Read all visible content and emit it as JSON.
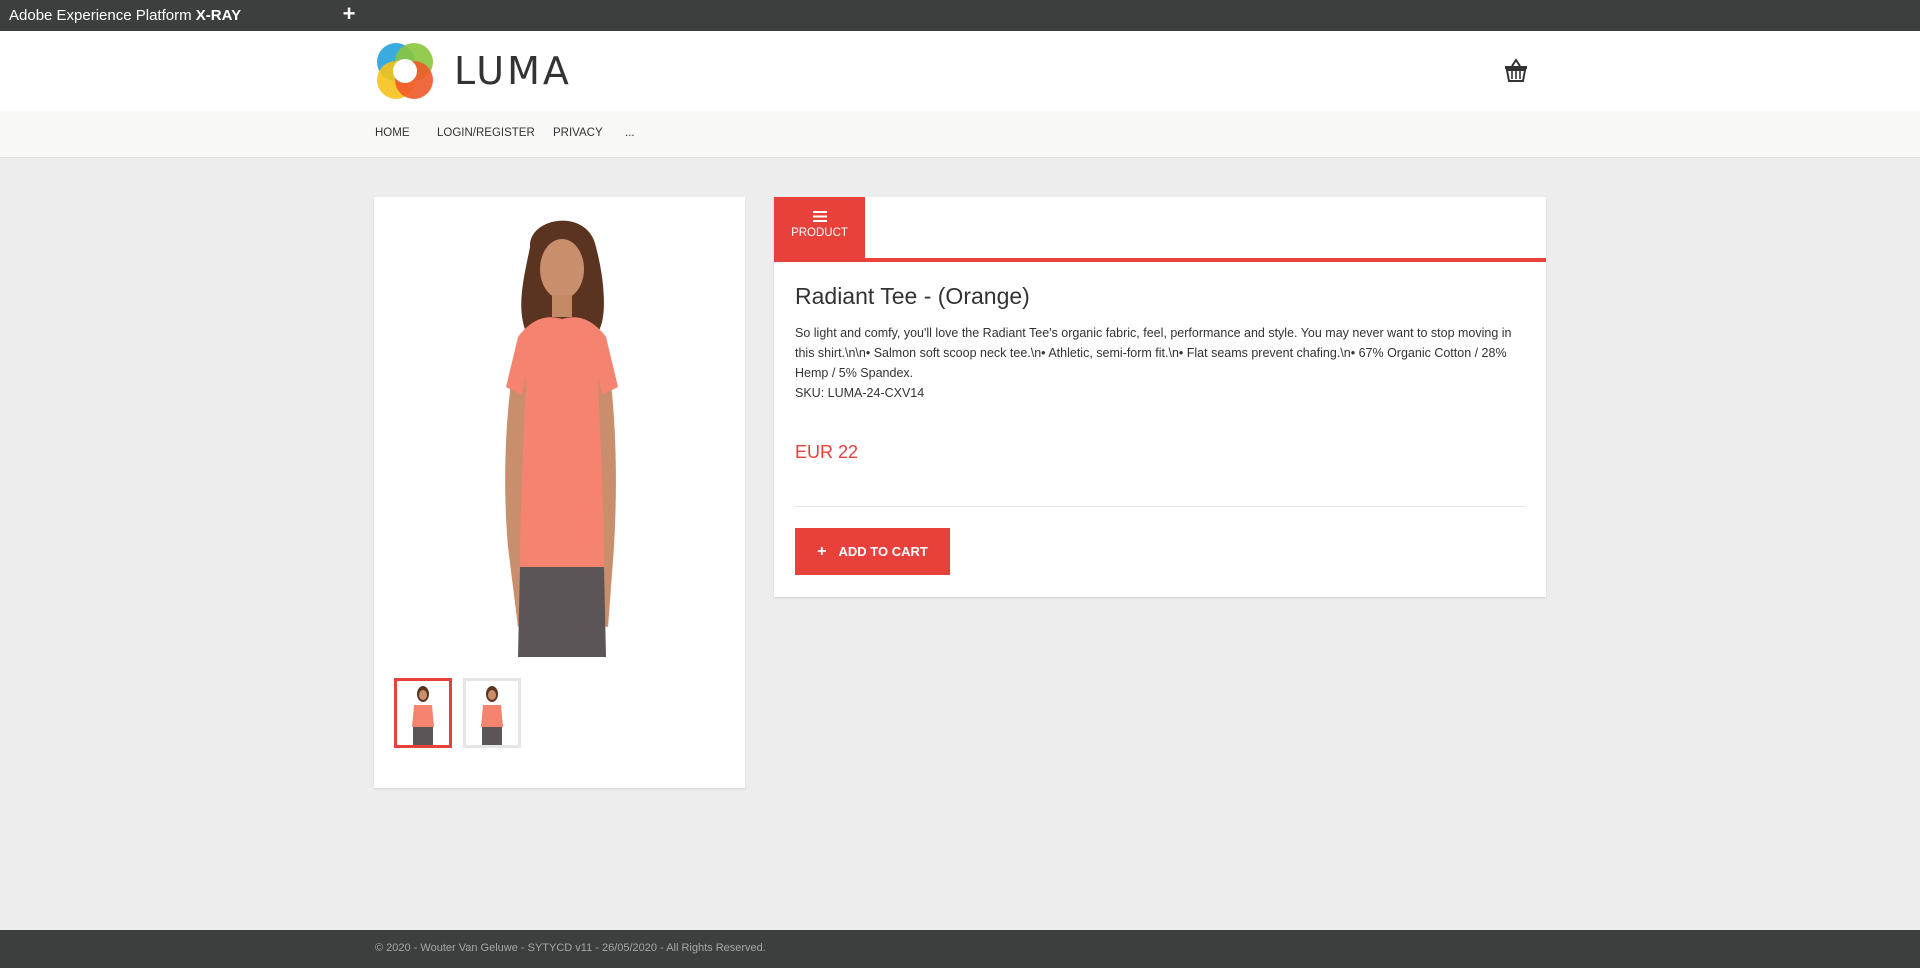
{
  "xray_bar": {
    "title_prefix": "Adobe Experience Platform ",
    "title_bold": "X-RAY",
    "add_icon": "+"
  },
  "header": {
    "logo_text": "LUMA",
    "cart_icon": "basket-icon"
  },
  "nav": {
    "items": [
      {
        "label": "HOME"
      },
      {
        "label": "LOGIN/REGISTER"
      },
      {
        "label": "PRIVACY"
      },
      {
        "label": "..."
      }
    ]
  },
  "product": {
    "tab_label": "PRODUCT",
    "tab_icon": "menu-icon",
    "title": "Radiant Tee - (Orange)",
    "description": "So light and comfy, you'll love the Radiant Tee's organic fabric, feel, performance and style. You may never want to stop moving in this shirt.\\n\\n• Salmon soft scoop neck tee.\\n• Athletic, semi-form fit.\\n• Flat seams prevent chafing.\\n• 67% Organic Cotton / 28% Hemp / 5% Spandex.",
    "sku": "SKU: LUMA-24-CXV14",
    "price": "EUR 22",
    "add_to_cart_label": "ADD TO CART",
    "add_to_cart_icon": "+"
  },
  "gallery": {
    "thumbnails": [
      {
        "state": "active"
      },
      {
        "state": "inactive"
      }
    ]
  },
  "footer": {
    "text": "© 2020 - Wouter Van Geluwe - SYTYCD v11 - 26/05/2020 - All Rights Reserved."
  },
  "colors": {
    "accent": "#e8403a",
    "topbar": "#3d3e3e",
    "background": "#ededed"
  }
}
